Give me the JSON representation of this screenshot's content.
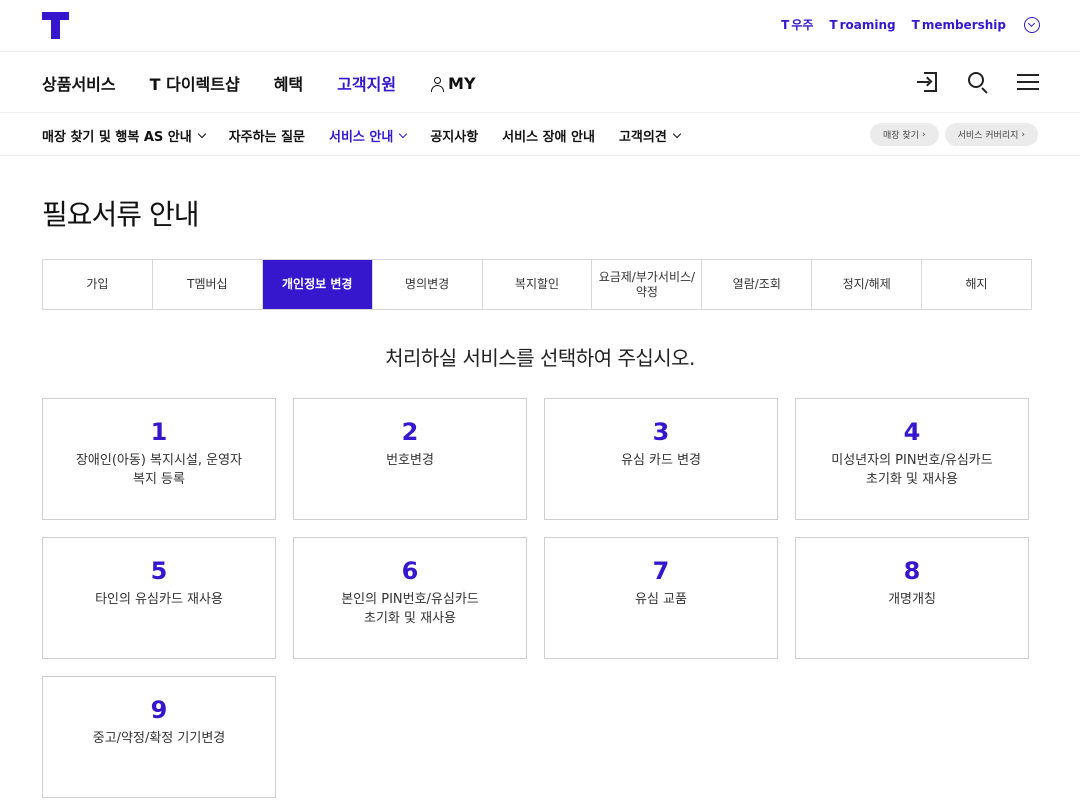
{
  "utility_links": [
    {
      "prefix": "T",
      "name": "우주"
    },
    {
      "prefix": "T",
      "name": "roaming"
    },
    {
      "prefix": "T",
      "name": "membership"
    }
  ],
  "main_nav": [
    "상품서비스",
    "T 다이렉트샵",
    "혜택",
    "고객지원",
    "MY"
  ],
  "main_nav_active": "고객지원",
  "sub_nav": [
    {
      "label": "매장 찾기 및 행복 AS 안내",
      "dropdown": true
    },
    {
      "label": "자주하는 질문",
      "dropdown": false
    },
    {
      "label": "서비스 안내",
      "dropdown": true,
      "active": true
    },
    {
      "label": "공지사항",
      "dropdown": false
    },
    {
      "label": "서비스 장애 안내",
      "dropdown": false
    },
    {
      "label": "고객의견",
      "dropdown": true
    }
  ],
  "quick_pills": [
    "매장 찾기",
    "서비스 커버리지"
  ],
  "page_title": "필요서류 안내",
  "tabs": [
    "가입",
    "T멤버십",
    "개인정보 변경",
    "명의변경",
    "복지할인",
    "요금제/부가서비스/\n약정",
    "열람/조회",
    "정지/해제",
    "해지"
  ],
  "active_tab": "개인정보 변경",
  "prompt": "처리하실 서비스를 선택하여 주십시오.",
  "services": [
    {
      "num": "1",
      "label": "장애인(아동) 복지시설, 운영자\n복지 등록"
    },
    {
      "num": "2",
      "label": "번호변경"
    },
    {
      "num": "3",
      "label": "유심 카드 변경"
    },
    {
      "num": "4",
      "label": "미성년자의 PIN번호/유심카드\n초기화 및 재사용"
    },
    {
      "num": "5",
      "label": "타인의 유심카드 재사용"
    },
    {
      "num": "6",
      "label": "본인의 PIN번호/유심카드\n초기화 및 재사용"
    },
    {
      "num": "7",
      "label": "유심 교품"
    },
    {
      "num": "8",
      "label": "개명개칭"
    },
    {
      "num": "9",
      "label": "중고/약정/확정 기기변경"
    }
  ],
  "colors": {
    "brand": "#3617ce",
    "border": "#cfcfcf"
  }
}
